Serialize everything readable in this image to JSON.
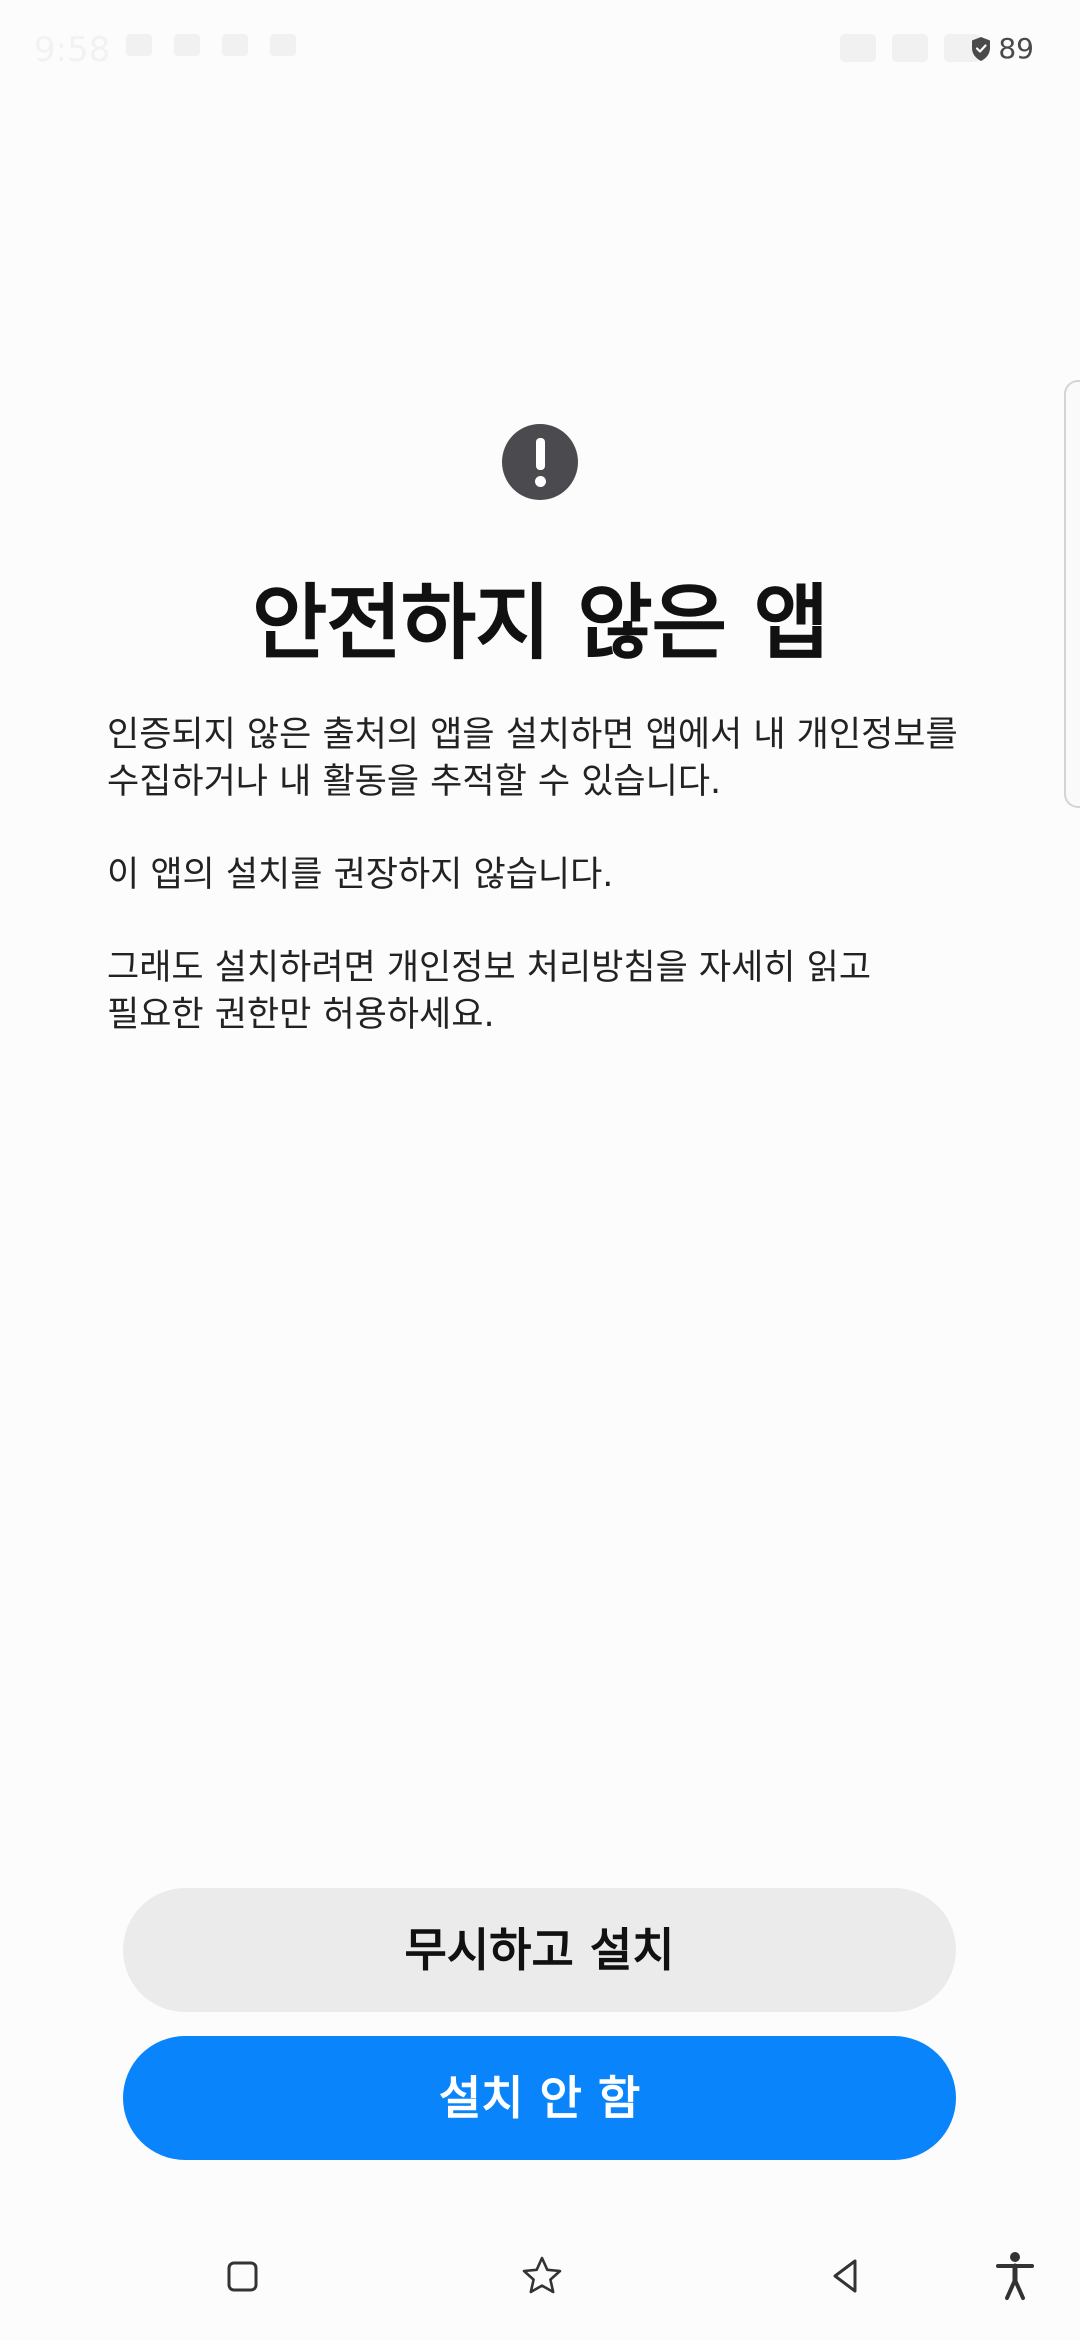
{
  "status_bar": {
    "time": "9:58",
    "battery_level": "89"
  },
  "dialog": {
    "icon": "exclamation-icon",
    "title": "안전하지 않은 앱",
    "paragraphs": [
      "인증되지 않은 출처의 앱을 설치하면 앱에서 내 개인정보를\n수집하거나 내 활동을 추적할 수 있습니다.",
      "이 앱의 설치를 권장하지 않습니다.",
      "그래도 설치하려면 개인정보 처리방침을 자세히 읽고\n필요한 권한만 허용하세요."
    ],
    "ignore_button": "무시하고 설치",
    "cancel_button": "설치 안 함"
  },
  "navigation": {
    "icons": [
      "recents-icon",
      "star-icon",
      "back-icon",
      "accessibility-icon"
    ]
  },
  "colors": {
    "background": "#fcfcfc",
    "primary_button": "#0a84fb",
    "secondary_button": "#ebebeb",
    "warning_icon": "#4b4b4f"
  }
}
